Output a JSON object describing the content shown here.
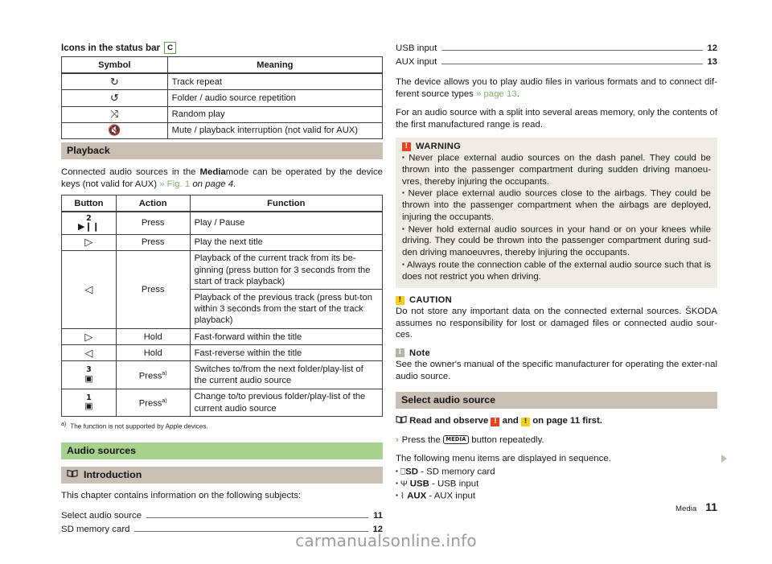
{
  "footer": {
    "section": "Media",
    "page_number": "11"
  },
  "watermark": "carmanualsonline.info",
  "left": {
    "status_bar_section": {
      "heading": "Icons in the status bar",
      "chapter_badge": "C",
      "table": {
        "headers": [
          "Symbol",
          "Meaning"
        ],
        "rows": [
          {
            "symbol": "↻",
            "meaning": "Track repeat"
          },
          {
            "symbol": "↺",
            "meaning": "Folder / audio source repetition"
          },
          {
            "symbol": "⤨",
            "meaning": "Random play"
          },
          {
            "symbol": "ὐ7",
            "meaning": "Mute / playback interruption (not valid for AUX)"
          }
        ]
      }
    },
    "playback": {
      "title": "Playback",
      "intro_pre": "Connected audio sources in the ",
      "intro_bold": "Media",
      "intro_mid": "mode can be operated by the device keys (not valid for AUX) ",
      "intro_ref": "» Fig. 1",
      "intro_ital": " on page 4",
      "intro_end": ".",
      "table": {
        "headers": [
          "Button",
          "Action",
          "Function"
        ],
        "rows": [
          {
            "num": "2",
            "icon": "▶❙❙",
            "action": "Press",
            "suffix": "",
            "function": "Play / Pause"
          },
          {
            "num": "",
            "icon": "▷",
            "action": "Press",
            "suffix": "",
            "function": "Play the next title"
          },
          {
            "num": "",
            "icon": "◁",
            "action": "Press",
            "suffix": "",
            "function": "Playback of the current track from its be-ginning (press button for 3 seconds from the start of track playback)"
          },
          {
            "num": "",
            "icon": "",
            "action": "",
            "suffix": "",
            "function": "Playback of the previous track (press but-ton within 3 seconds from the start of the track playback)"
          },
          {
            "num": "",
            "icon": "▷",
            "action": "Hold",
            "suffix": "",
            "function": "Fast-forward within the title"
          },
          {
            "num": "",
            "icon": "◁",
            "action": "Hold",
            "suffix": "",
            "function": "Fast-reverse within the title"
          },
          {
            "num": "3",
            "icon": "▣",
            "action": "Press",
            "suffix": "a)",
            "function": "Switches to/from the next folder/play-list of the current audio source"
          },
          {
            "num": "1",
            "icon": "▣",
            "action": "Press",
            "suffix": "a)",
            "function": "Change to/to previous folder/play-list of the current audio source"
          }
        ]
      },
      "footnote_marker": "a)",
      "footnote_text": "The function is not supported by Apple devices."
    },
    "audio_sources": {
      "title": "Audio sources",
      "intro_title": "Introduction",
      "intro_icon": "book-icon",
      "lead_in": "This chapter contains information on the following subjects:",
      "toc": [
        {
          "label": "Select audio source",
          "page": "11"
        },
        {
          "label": "SD memory card",
          "page": "12"
        }
      ]
    }
  },
  "right": {
    "toc": [
      {
        "label": "USB input",
        "page": "12"
      },
      {
        "label": "AUX input",
        "page": "13"
      }
    ],
    "para1_pre": "The device allows you to play audio files in various formats and to connect dif-ferent source types ",
    "para1_ref": "» page 13",
    "para1_end": ".",
    "para2": "For an audio source with a split into several areas memory, only the contents of the first manufactured range is read.",
    "warning": {
      "title": "WARNING",
      "bullets": [
        "Never place external audio sources on the dash panel. They could be thrown into the passenger compartment during sudden driving manoeu-vres, thereby injuring the occupants.",
        "Never place external audio sources close to the airbags. They could be thrown into the passenger compartment when the airbags are deployed, injuring the occupants.",
        "Never hold external audio sources in your hand or on your knees while driving. They could be thrown into the passenger compartment during sud-den driving manoeuvres, thereby injuring the occupants.",
        "Always route the connection cable of the external audio source such that is does not restrict you when driving."
      ]
    },
    "caution": {
      "title": "CAUTION",
      "text": "Do not store any important data on the connected external sources. ŠKODA assumes no responsibility for lost or damaged files or connected audio sour-ces."
    },
    "note": {
      "title": "Note",
      "text": "See the owner's manual of the specific manufacturer for operating the exter-nal audio source."
    },
    "select_audio_source": {
      "title": "Select audio source",
      "read_observe_pre": "Read and observe ",
      "read_observe_mid": " and ",
      "read_observe_end": " on page 11 first.",
      "step": "Press the",
      "step_key": "MEDIA",
      "step_end": "button repeatedly.",
      "sequence_lead": "The following menu items are displayed in sequence.",
      "items": [
        {
          "icon": "⎕",
          "name": "SD",
          "desc": " - SD memory card"
        },
        {
          "icon": "Ψ",
          "name": "USB",
          "desc": " - USB input"
        },
        {
          "icon": "⌇",
          "name": "AUX",
          "desc": " - AUX input"
        }
      ]
    }
  }
}
